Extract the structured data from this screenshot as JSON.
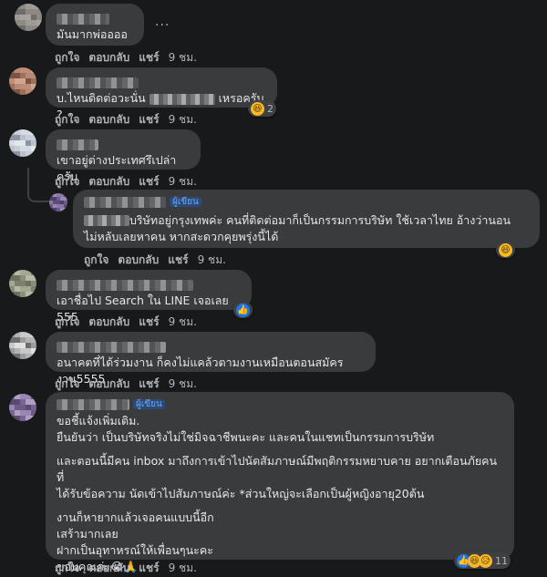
{
  "actions": {
    "like": "ถูกใจ",
    "reply": "ตอบกลับ",
    "share": "แชร์",
    "time": "9 ชม."
  },
  "author_badge": "ผู้เขียน",
  "more_menu": "...",
  "comments": [
    {
      "text": "มันมากพ่ออออ"
    },
    {
      "text_a": "บ.ไหนติดต่อวะนั่น",
      "text_b": "เหรอครับ ?",
      "reaction_count": "2",
      "reaction": "haha"
    },
    {
      "text": "เขาอยู่ต่างประเทศรึเปล่าครับ"
    },
    {
      "line1": "บริษัทอยู่กรุงเทพค่ะ คนที่ติดต่อมาก็เป็นกรรมการบริษัท ใช้เวลาไทย อ้างว่านอน",
      "line2": "ไม่หลับเลยหาคน หากสะดวกคุยพรุ่งนี้ได้",
      "reaction": "haha"
    },
    {
      "text": "เอาชื่อไป Search ใน LINE เจอเลย 555",
      "reaction": "like"
    },
    {
      "text": "อนาคตที่ได้ร่วมงาน ก็คงไม่แคล้วตามงานเหมือนตอนสมัครงาน5555"
    },
    {
      "lines": [
        "ขอชี้แจ้งเพิ่มเติม.",
        "ยืนยันว่า เป็นบริษัทจริงไม่ใช่มิจฉาชีพนะคะ และคนในแชทเป็นกรรมการบริษัท",
        "และตอนนี้มีคน inbox มาถึงการเข้าไปนัดสัมภาษณ์มีพฤติกรรมหยาบคาย อยากเตือนภัยคนที่",
        "ได้รับข้อความ นัดเข้าไปสัมภาษณ์ค่ะ *ส่วนใหญ่จะเลือกเป็นผู้หญิงอายุ20ต้น",
        "งานก็หายากแล้วเจอคนแบบนี้อีก",
        "เสร้ามากเลย",
        "ฝากเป็นอุทาหรณ์ให้เพื่อนๆนะคะ",
        "ขอบคุณค่ะ😭🙏"
      ],
      "reaction_count": "11"
    }
  ]
}
